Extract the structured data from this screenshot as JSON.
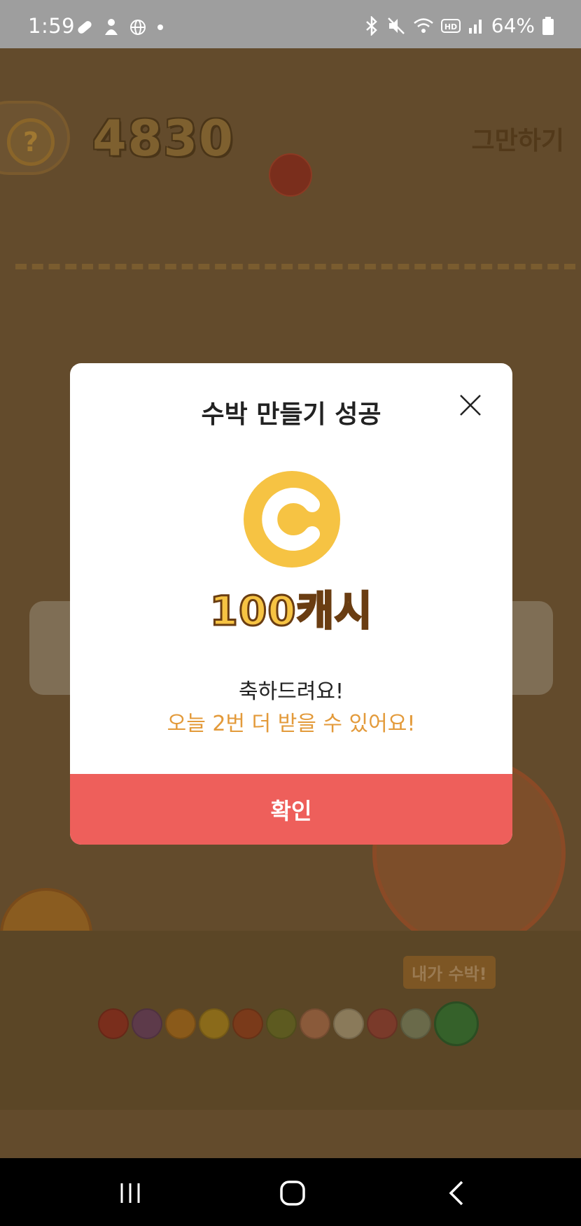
{
  "status_bar": {
    "time": "1:59",
    "battery": "64%",
    "icons": [
      "pill-icon",
      "person-icon",
      "globe-icon",
      "dot-icon",
      "bluetooth-icon",
      "mute-icon",
      "wifi-icon",
      "hd-icon",
      "signal-icon",
      "battery-icon"
    ]
  },
  "game": {
    "score": "4830",
    "help_symbol": "?",
    "stop_label": "그만하기",
    "me_label": "내가 수박!",
    "progress_fruit_colors": [
      "#7a2e1c",
      "#5d3a4a",
      "#8a5a1a",
      "#8a6a1a",
      "#7a3a1a",
      "#5d5a20",
      "#8a5a3a",
      "#8a7a5a",
      "#7a3a2a",
      "#6a6a4a"
    ]
  },
  "modal": {
    "title": "수박 만들기 성공",
    "reward": "100캐시",
    "congrats": "축하드려요!",
    "remaining_text": "오늘 2번 더 받을 수 있어요!",
    "confirm_label": "확인",
    "coin_color": "#f6c343"
  }
}
